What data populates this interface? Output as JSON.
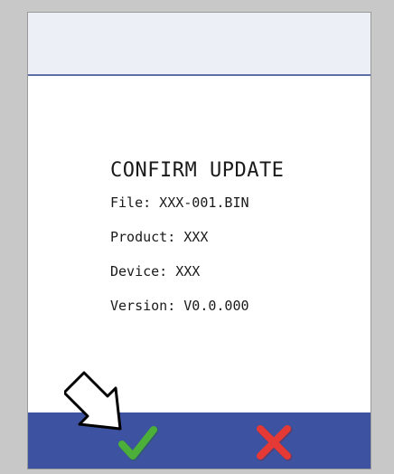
{
  "dialog": {
    "title": "CONFIRM UPDATE",
    "file_line": "File: XXX-001.BIN",
    "product_line": "Product: XXX",
    "device_line": "Device: XXX",
    "version_line": "Version: V0.0.000"
  },
  "actions": {
    "confirm_icon": "checkmark-icon",
    "cancel_icon": "cross-icon"
  },
  "colors": {
    "action_bar": "#3d52a0",
    "header_bar": "#eceff6",
    "confirm": "#4caf3a",
    "cancel": "#e53935",
    "frame": "#c8c8c8"
  },
  "pointer_icon": "arrow-pointer-icon"
}
